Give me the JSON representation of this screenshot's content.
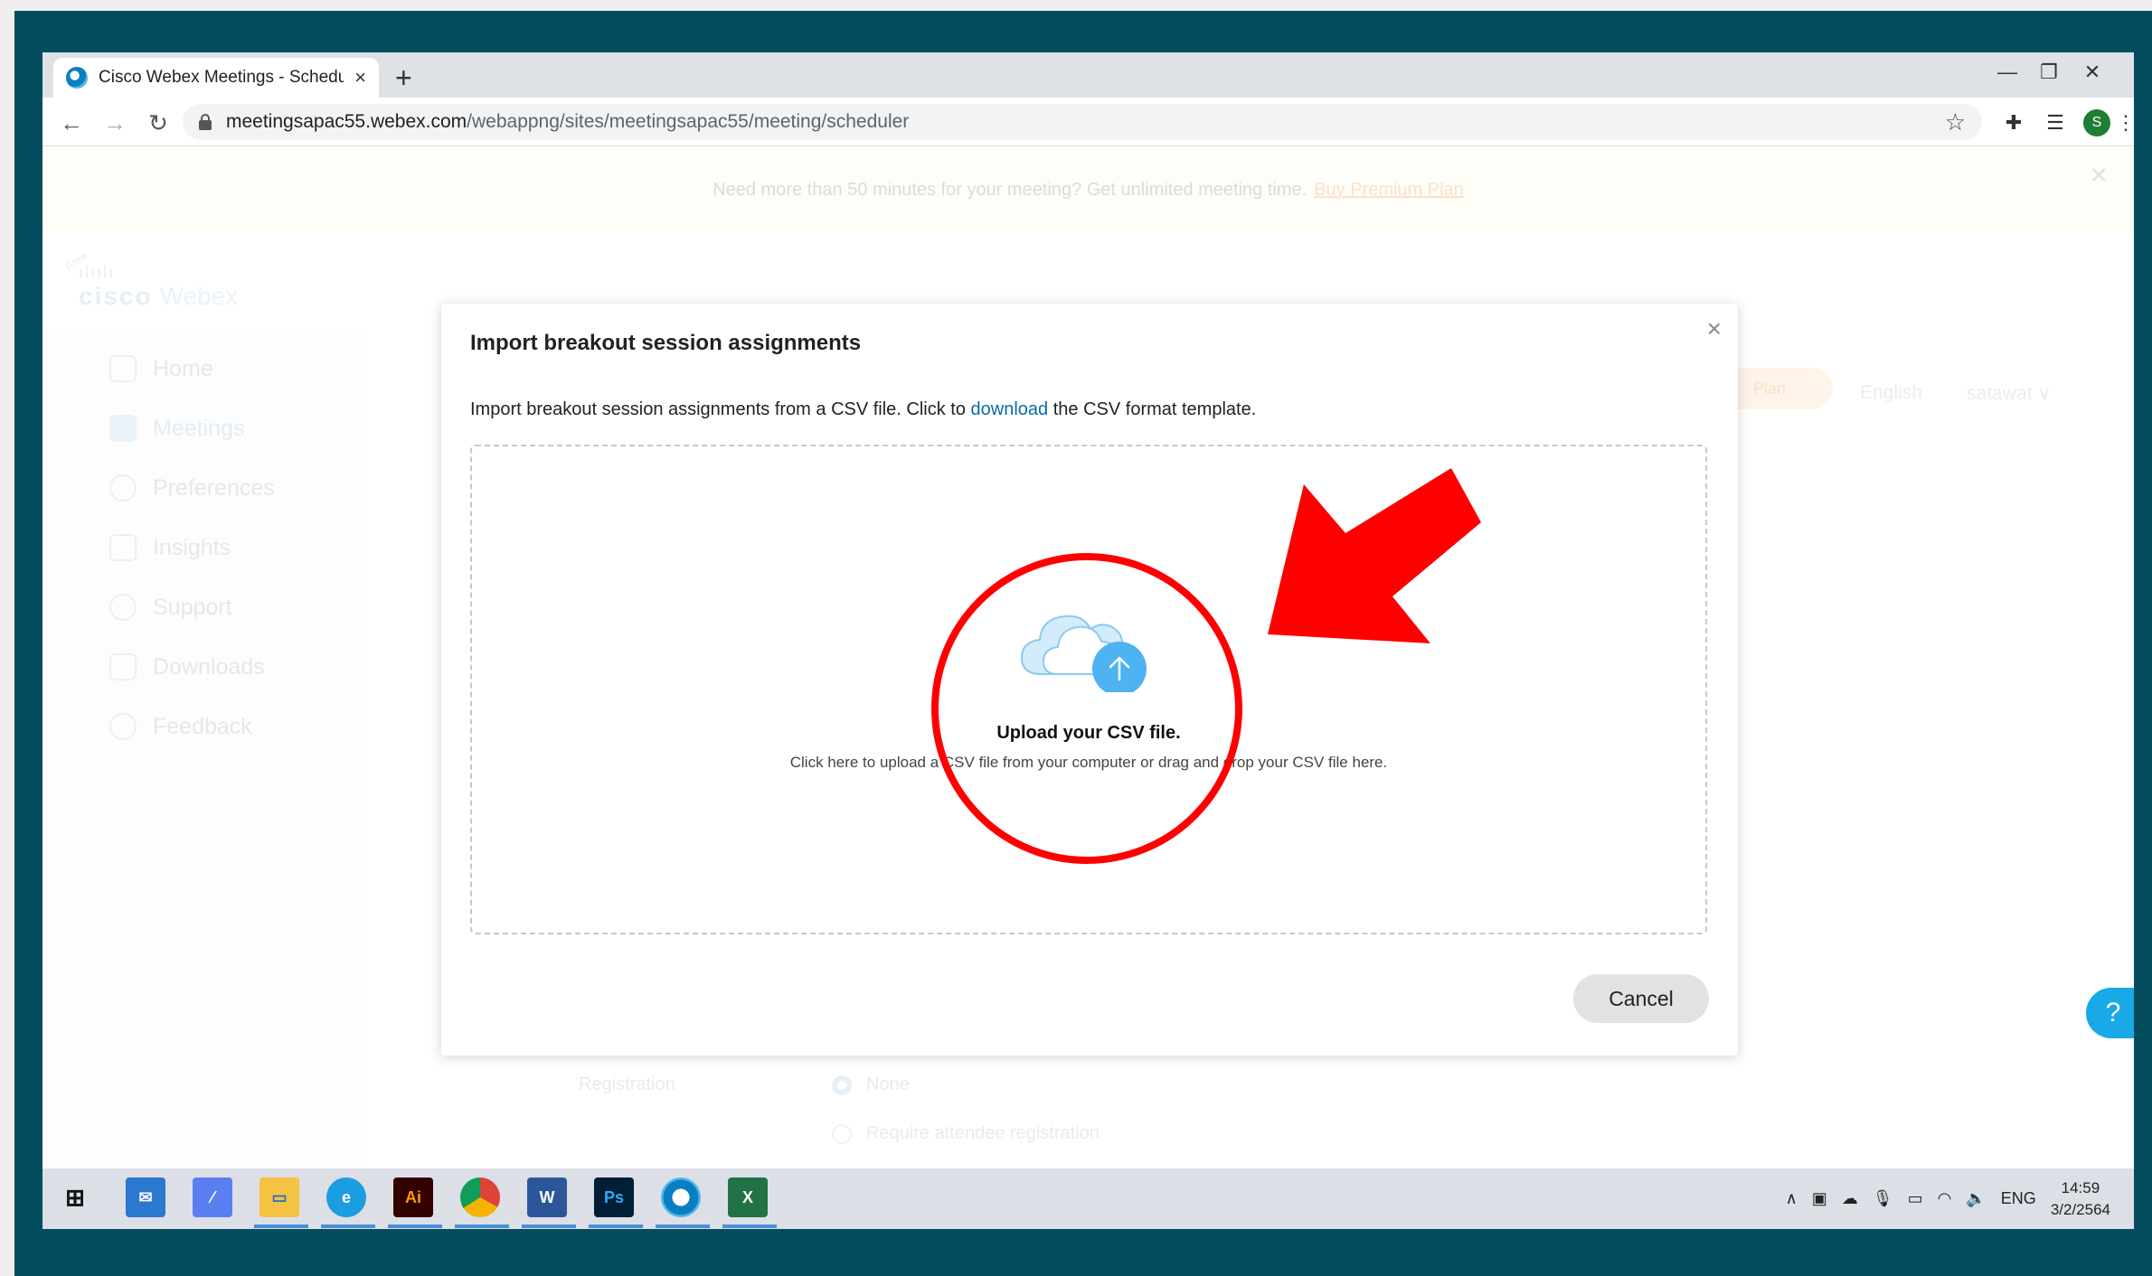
{
  "browser": {
    "tab_title": "Cisco Webex Meetings - Schedul",
    "tab_close": "×",
    "new_tab": "+",
    "url_host": "meetingsapac55.webex.com",
    "url_path": "/webappng/sites/meetingsapac55/meeting/scheduler",
    "profile_initial": "S",
    "window_controls": {
      "minimize": "—",
      "restore": "❐",
      "close": "✕"
    }
  },
  "page": {
    "promo_text": "Need more than 50 minutes for your meeting? Get unlimited meeting time.",
    "promo_link": "Buy Premium Plan",
    "logo_brand": "cisco",
    "logo_product": "Webex",
    "logo_badge": "Free",
    "nav": [
      {
        "label": "Home"
      },
      {
        "label": "Meetings"
      },
      {
        "label": "Preferences"
      },
      {
        "label": "Insights"
      },
      {
        "label": "Support"
      },
      {
        "label": "Downloads"
      },
      {
        "label": "Feedback"
      }
    ],
    "plan_pill": "Plan",
    "language": "English",
    "user": "satawat ∨",
    "registration_label": "Registration",
    "registration_options": [
      "None",
      "Require attendee registration"
    ]
  },
  "dialog": {
    "title": "Import breakout session assignments",
    "desc_before": "Import breakout session assignments from a CSV file. Click to ",
    "desc_link": "download",
    "desc_after": " the CSV format template.",
    "upload_title": "Upload your CSV file.",
    "upload_subtitle": "Click here to upload a CSV file from your computer or drag and drop your CSV file here.",
    "cancel_label": "Cancel",
    "close": "×"
  },
  "help_label": "?",
  "taskbar": {
    "language": "ENG",
    "time": "14:59",
    "date": "3/2/2564",
    "apps": [
      "windows-start",
      "mail",
      "edit-app",
      "file-explorer",
      "edge",
      "illustrator",
      "chrome",
      "word",
      "photoshop",
      "webex",
      "excel"
    ]
  },
  "colors": {
    "frame": "#034d5f",
    "accent_link": "#0a6aa8",
    "annotation_red": "#ff0000",
    "upload_blue": "#4db3f2"
  }
}
